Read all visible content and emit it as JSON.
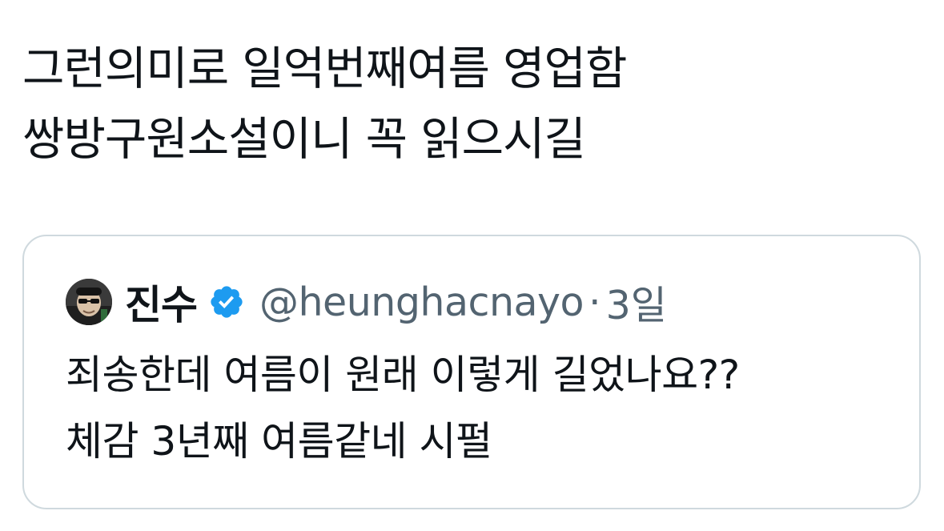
{
  "tweet": {
    "text_lines": [
      "그런의미로 일억번째여름 영업함",
      "쌍방구원소설이니 꼭 읽으시길"
    ]
  },
  "quoted_tweet": {
    "author_name": "진수",
    "verified": true,
    "handle": "@heunghacnayo",
    "separator": "·",
    "time": "3일",
    "text_lines": [
      "죄송한데 여름이 원래 이렇게 길었나요??",
      "체감 3년째 여름같네 시펄"
    ]
  },
  "colors": {
    "text_primary": "#0f1419",
    "text_secondary": "#536471",
    "card_border": "#cfd9de",
    "verified_badge": "#1d9bf0"
  },
  "icons": {
    "verified": "verified-badge-icon",
    "avatar": "avatar"
  }
}
